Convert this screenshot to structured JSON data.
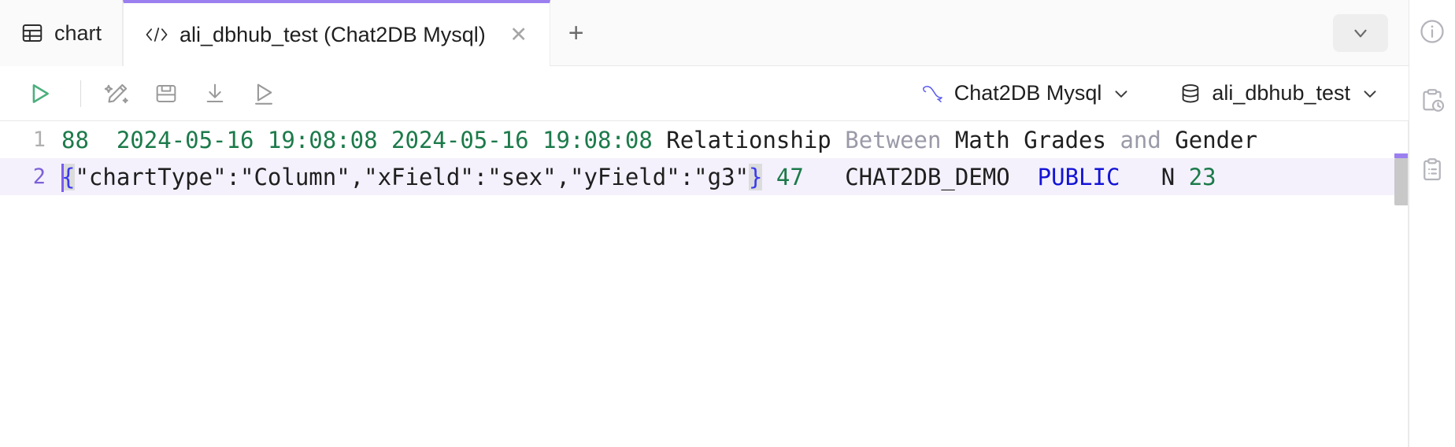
{
  "window": {
    "tabs": [
      {
        "label": "chart",
        "icon": "table-grid-icon",
        "active": false,
        "closable": false
      },
      {
        "label": "ali_dbhub_test (Chat2DB Mysql)",
        "icon": "code-brackets-icon",
        "active": true,
        "closable": true,
        "close_label": "✕"
      }
    ],
    "add_tab_label": "+",
    "overflow_icon": "chevron-down-icon"
  },
  "toolbar": {
    "buttons": [
      {
        "name": "run-sql-button",
        "icon": "play-triangle-icon",
        "color": "#4caf7d"
      },
      {
        "name": "ai-magic-edit-button",
        "icon": "magic-wand-pencil-icon",
        "color": "#9a9a9a"
      },
      {
        "name": "save-button",
        "icon": "floppy-disk-icon",
        "color": "#9a9a9a"
      },
      {
        "name": "download-button",
        "icon": "download-arrow-icon",
        "color": "#9a9a9a"
      },
      {
        "name": "execute-selection-button",
        "icon": "play-underline-icon",
        "color": "#9a9a9a"
      }
    ],
    "connection": {
      "icon": "mysql-dolphin-icon",
      "label": "Chat2DB Mysql",
      "chevron": "chevron-down-icon"
    },
    "database": {
      "icon": "database-cylinder-icon",
      "label": "ali_dbhub_test",
      "chevron": "chevron-down-icon"
    }
  },
  "editor": {
    "lines": [
      {
        "number": "1",
        "current": false,
        "tokens": [
          {
            "text": "88  ",
            "style": "green"
          },
          {
            "text": "2024-05-16 19:08:08 ",
            "style": "green"
          },
          {
            "text": "2024-05-16 19:08:08 ",
            "style": "green"
          },
          {
            "text": "Relationship ",
            "style": "black"
          },
          {
            "text": "Between ",
            "style": "gray"
          },
          {
            "text": "Math Grades ",
            "style": "black"
          },
          {
            "text": "and ",
            "style": "gray"
          },
          {
            "text": "Gender",
            "style": "black"
          }
        ]
      },
      {
        "number": "2",
        "current": true,
        "tokens": [
          {
            "text": "{",
            "style": "brace"
          },
          {
            "text": "\"chartType\":\"Column\",\"xField\":\"sex\",\"yField\":\"g3\"",
            "style": "black"
          },
          {
            "text": "}",
            "style": "brace"
          },
          {
            "text": " 47   ",
            "style": "green"
          },
          {
            "text": "CHAT2DB_DEMO  ",
            "style": "black"
          },
          {
            "text": "PUBLIC   ",
            "style": "blue"
          },
          {
            "text": "N ",
            "style": "black"
          },
          {
            "text": "23",
            "style": "green"
          }
        ]
      }
    ]
  },
  "rail": {
    "items": [
      {
        "name": "info-icon",
        "title": "info"
      },
      {
        "name": "clipboard-clock-icon",
        "title": "history"
      },
      {
        "name": "clipboard-list-icon",
        "title": "saved"
      }
    ]
  },
  "colors": {
    "accent_purple": "#9b7ff0",
    "run_green": "#4caf7d",
    "string_green": "#1c7a4a",
    "keyword_blue": "#1414d6",
    "current_line_bg": "#f4f1fd"
  }
}
